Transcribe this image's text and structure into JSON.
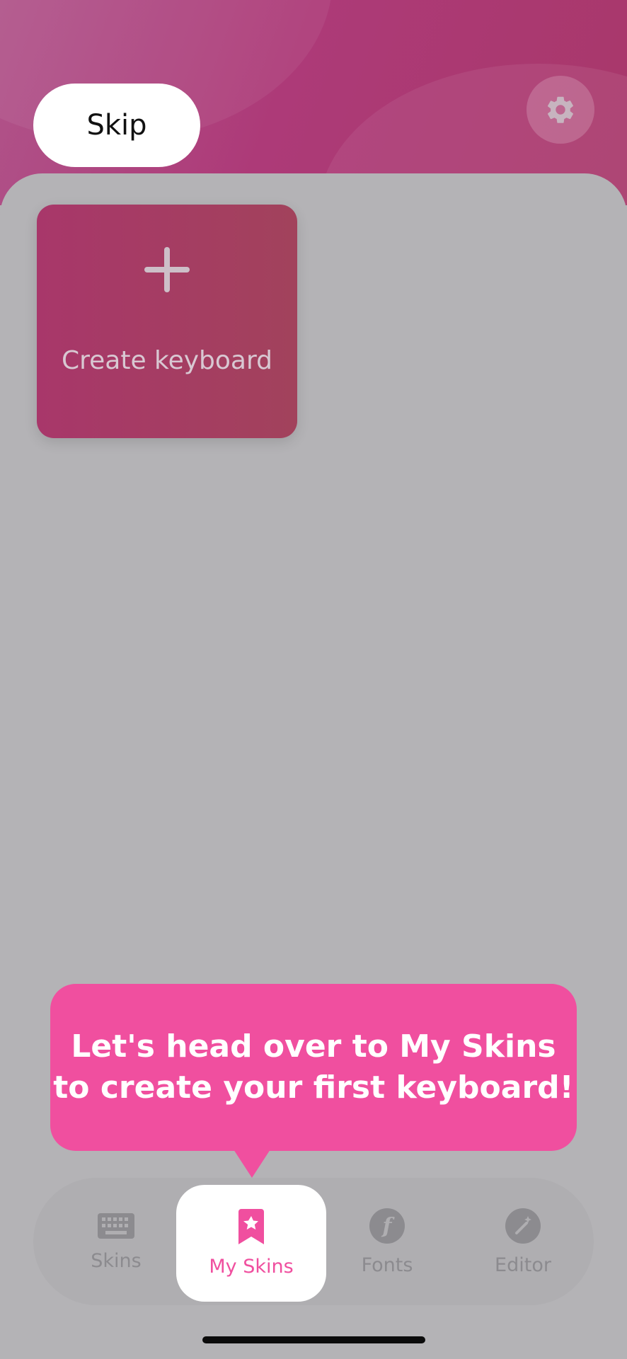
{
  "header": {
    "skip_label": "Skip"
  },
  "create_card": {
    "label": "Create keyboard"
  },
  "tooltip": {
    "line1": "Let's head over to My Skins",
    "line2": "to create your first keyboard!"
  },
  "tabbar": {
    "tabs": [
      {
        "label": "Skins",
        "icon": "keyboard-icon"
      },
      {
        "label": "My Skins",
        "icon": "bookmark-star-icon",
        "active": true
      },
      {
        "label": "Fonts",
        "icon": "font-f-icon"
      },
      {
        "label": "Editor",
        "icon": "magic-wand-icon"
      }
    ]
  },
  "colors": {
    "accent": "#f04f9f",
    "header": "#ad3a78",
    "overlay_bg": "#b4b3b6"
  }
}
